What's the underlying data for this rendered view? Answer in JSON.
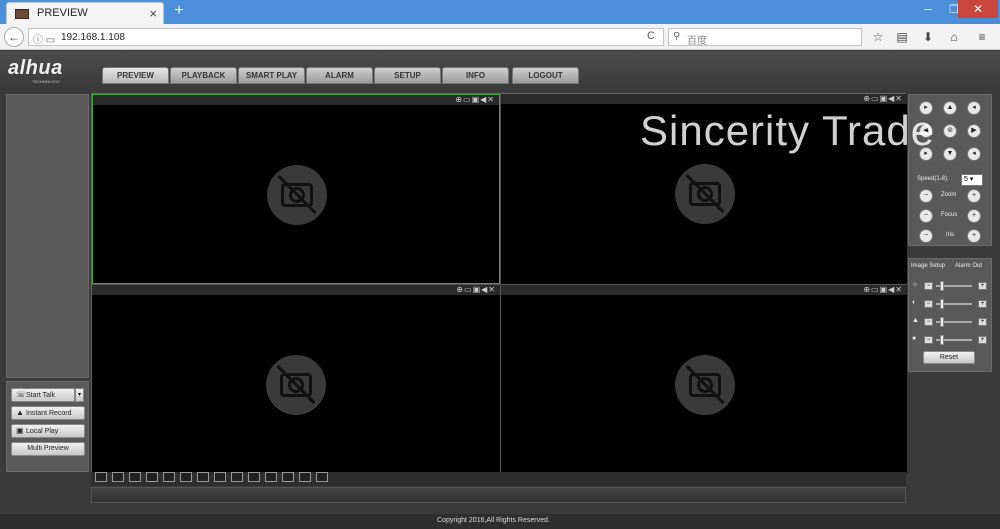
{
  "browser": {
    "tab_title": "PREVIEW",
    "tab_close": "×",
    "new_tab": "+",
    "minimize": "─",
    "restore": "❐",
    "close": "✕",
    "url": "192.168.1.108",
    "search_placeholder": "百度",
    "reload": "C"
  },
  "app": {
    "logo": "alhua",
    "logo_sub": "TECHNOLOGY",
    "nav": [
      "PREVIEW",
      "PLAYBACK",
      "SMART PLAY",
      "ALARM",
      "SETUP",
      "INFO",
      "LOGOUT"
    ],
    "active_nav": "PREVIEW"
  },
  "left_controls": {
    "start_talk": "Start Talk",
    "instant_record": "Instant Record",
    "local_play": "Local Play",
    "multi_preview": "Multi Preview"
  },
  "ptz": {
    "speed_label": "Speed(1-8):",
    "speed_value": "5",
    "zoom_label": "Zoom",
    "focus_label": "Focus",
    "iris_label": "Iris"
  },
  "image_setup": {
    "tab1": "Image Setup",
    "tab2": "Alarm Out",
    "reset": "Reset"
  },
  "footer": {
    "copyright": "Copyright 2016,All Rights Reserved."
  },
  "watermark": "Sincerity Trade"
}
